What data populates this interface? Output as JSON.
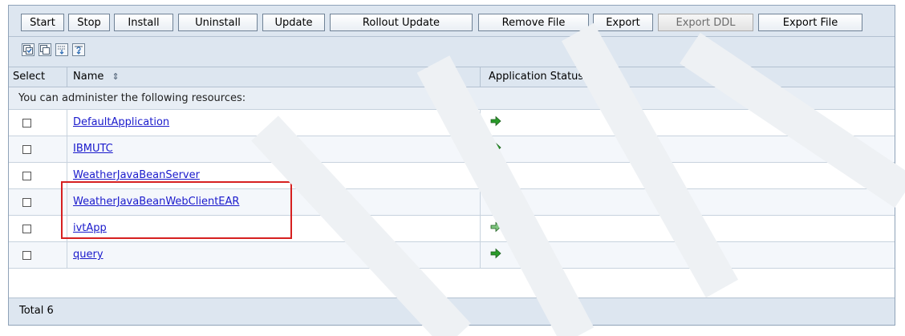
{
  "toolbar": {
    "buttons": [
      {
        "label": "Start",
        "enabled": true
      },
      {
        "label": "Stop",
        "enabled": true
      },
      {
        "label": "Install",
        "enabled": true
      },
      {
        "label": "Uninstall",
        "enabled": true
      },
      {
        "label": "Update",
        "enabled": true
      },
      {
        "label": "Rollout Update",
        "enabled": true
      },
      {
        "label": "Remove File",
        "enabled": true
      },
      {
        "label": "Export",
        "enabled": true
      },
      {
        "label": "Export DDL",
        "enabled": false
      },
      {
        "label": "Export File",
        "enabled": true
      }
    ]
  },
  "icon_toolbar": {
    "icons": [
      "select-all-icon",
      "deselect-all-icon",
      "show-filter-icon",
      "clear-filter-icon"
    ]
  },
  "table": {
    "columns": {
      "select": "Select",
      "name": "Name",
      "status": "Application Status"
    },
    "sort_icon": "sort-icon",
    "refresh_icon": "refresh-status-icon",
    "note": "You can administer the following resources:",
    "rows": [
      {
        "name": "DefaultApplication",
        "status": "started",
        "checked": false
      },
      {
        "name": "IBMUTC",
        "status": "started",
        "checked": false
      },
      {
        "name": "WeatherJavaBeanServer",
        "status": "stopped",
        "checked": false
      },
      {
        "name": "WeatherJavaBeanWebClientEAR",
        "status": "stopped",
        "checked": false
      },
      {
        "name": "ivtApp",
        "status": "partially-started",
        "checked": false
      },
      {
        "name": "query",
        "status": "started",
        "checked": false
      }
    ],
    "total": "Total 6"
  },
  "colors": {
    "header_bg": "#dde6f0",
    "link": "#1a1acc",
    "highlight": "#d62020",
    "started": "#2a9b2a",
    "stopped": "#c0272d"
  }
}
